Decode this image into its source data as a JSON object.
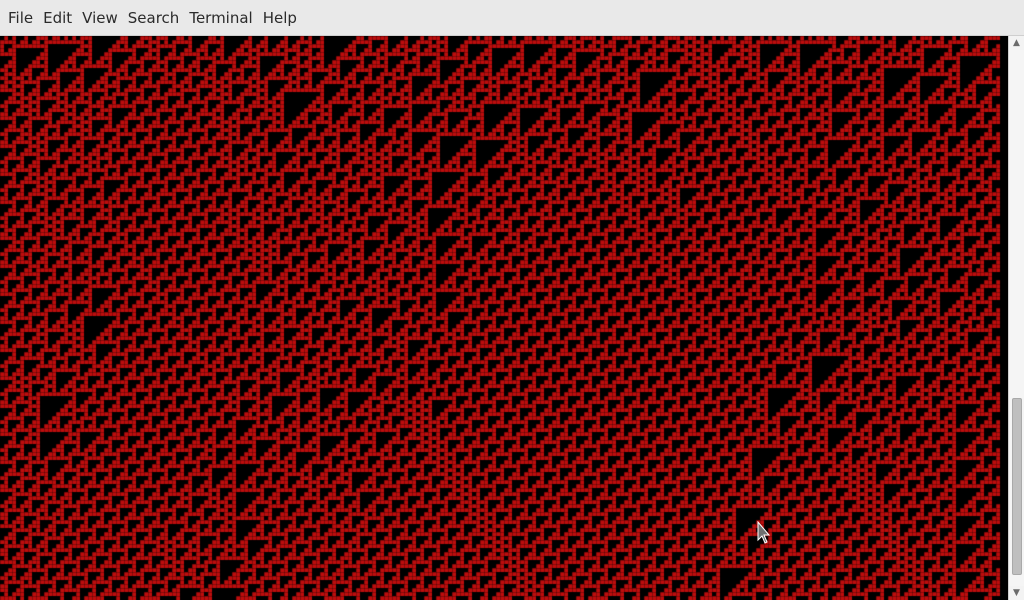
{
  "window": {
    "menu": [
      {
        "name": "menu-file",
        "label": "File"
      },
      {
        "name": "menu-edit",
        "label": "Edit"
      },
      {
        "name": "menu-view",
        "label": "View"
      },
      {
        "name": "menu-search",
        "label": "Search"
      },
      {
        "name": "menu-terminal",
        "label": "Terminal"
      },
      {
        "name": "menu-help",
        "label": "Help"
      }
    ]
  },
  "terminal": {
    "background_color": "#000000",
    "glyph_color": "#bd0d0d",
    "content": "red cellular-automaton-style pattern filling the terminal"
  },
  "scrollbar": {
    "thumb_start_fraction": 0.65,
    "thumb_end_fraction": 0.98,
    "up_icon": "scroll-up-arrow-icon",
    "down_icon": "scroll-down-arrow-icon"
  },
  "pointer": {
    "icon": "mouse-pointer-icon"
  }
}
